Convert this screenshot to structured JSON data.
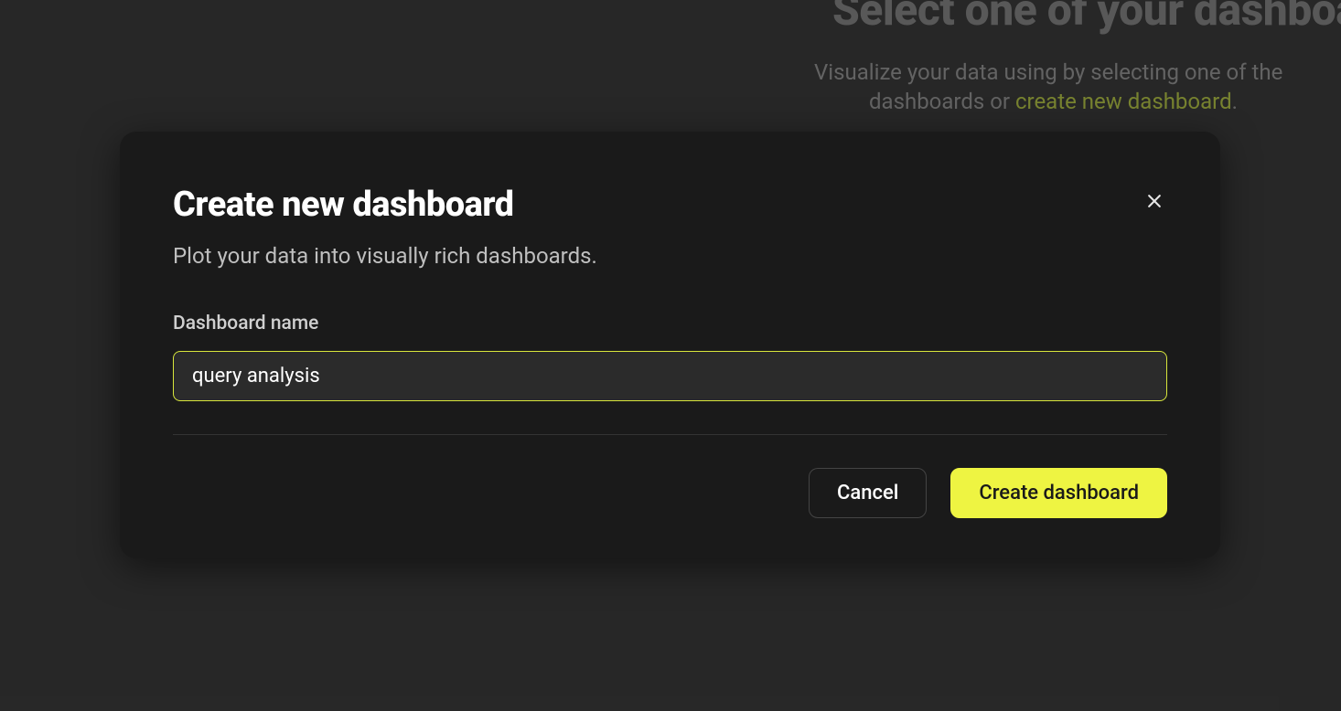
{
  "background": {
    "heading": "Select one of your dashboards",
    "subtext_prefix": "Visualize your data using by selecting one of the",
    "subtext_line2_prefix": "dashboards or ",
    "link_text": "create new dashboard",
    "subtext_suffix": "."
  },
  "modal": {
    "title": "Create new dashboard",
    "subtitle": "Plot your data into visually rich dashboards.",
    "field_label": "Dashboard name",
    "input_value": "query analysis",
    "cancel_label": "Cancel",
    "create_label": "Create dashboard"
  }
}
